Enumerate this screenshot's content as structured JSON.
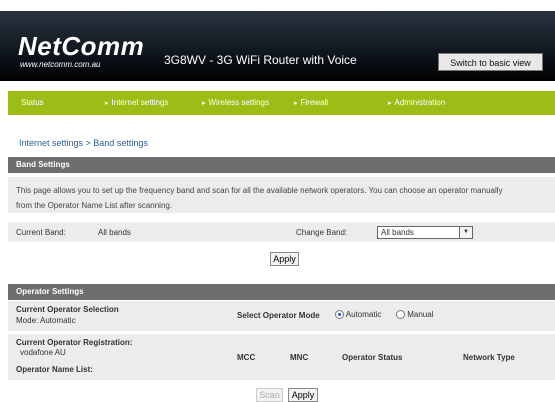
{
  "header": {
    "logo": "NetComm",
    "logo_url": "www.netcomm.com.au",
    "product_title": "3G8WV - 3G WiFi Router with Voice",
    "basic_view_button": "Switch to basic view"
  },
  "nav": {
    "items": [
      {
        "label": "Status"
      },
      {
        "label": "Internet settings"
      },
      {
        "label": "Wireless settings"
      },
      {
        "label": "Firewall"
      },
      {
        "label": "Administration"
      }
    ]
  },
  "breadcrumb": "Internet settings > Band settings",
  "band_settings": {
    "title": "Band Settings",
    "description_line1": "This page allows you to set up the frequency band and scan for all the available network operators. You can choose an operator manually",
    "description_line2": "from the Operator Name List after scanning.",
    "current_band_label": "Current Band:",
    "current_band_value": "All bands",
    "change_band_label": "Change Band:",
    "change_band_selected": "All bands",
    "apply_label": "Apply"
  },
  "operator_settings": {
    "title": "Operator Settings",
    "current_selection_label": "Current Operator Selection",
    "mode_line": "Mode: Automatic",
    "select_mode_label": "Select Operator Mode",
    "mode_automatic": "Automatic",
    "mode_manual": "Manual",
    "mode_selected": "Automatic",
    "registration_label": "Current Operator Registration:",
    "registration_value": "vodafone AU",
    "name_list_label": "Operator Name List:",
    "columns": [
      "MCC",
      "MNC",
      "Operator Status",
      "Network Type"
    ],
    "scan_label": "Scan",
    "apply_label": "Apply"
  }
}
